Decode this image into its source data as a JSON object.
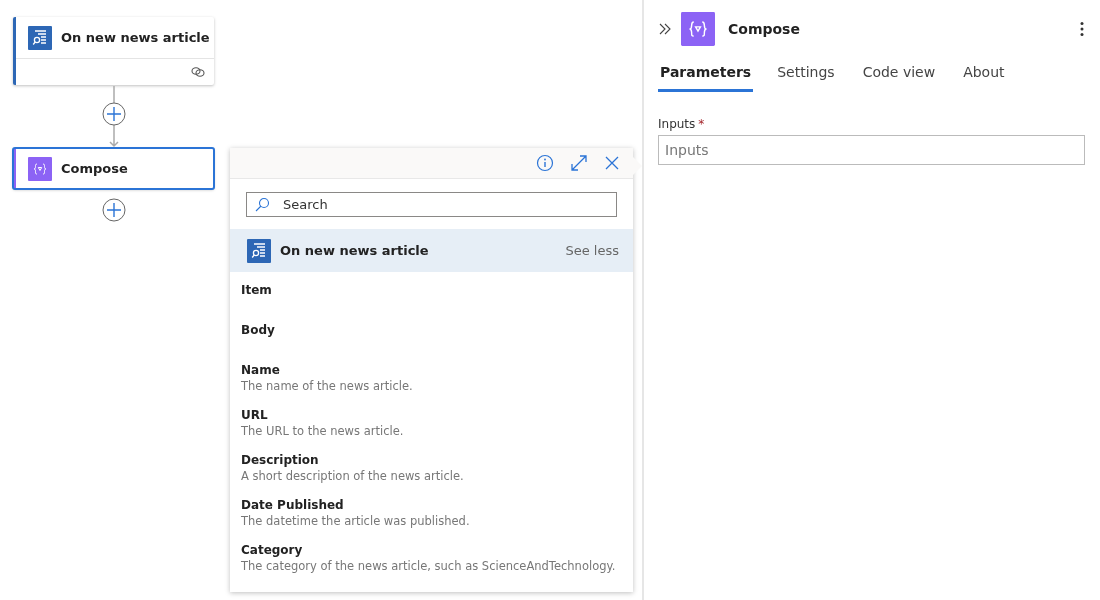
{
  "canvas": {
    "nodes": [
      {
        "title": "On new news article",
        "kind": "trigger",
        "selected": false
      },
      {
        "title": "Compose",
        "kind": "compose",
        "selected": true
      }
    ]
  },
  "dynamic_content": {
    "search": {
      "placeholder": "Search"
    },
    "group": {
      "title": "On new news article",
      "toggle": "See less"
    },
    "items": [
      {
        "title": "Item"
      },
      {
        "title": "Body"
      },
      {
        "title": "Name",
        "description": "The name of the news article."
      },
      {
        "title": "URL",
        "description": "The URL to the news article."
      },
      {
        "title": "Description",
        "description": "A short description of the news article."
      },
      {
        "title": "Date Published",
        "description": "The datetime the article was published."
      },
      {
        "title": "Category",
        "description": "The category of the news article, such as ScienceAndTechnology."
      }
    ]
  },
  "panel": {
    "title": "Compose",
    "tabs": [
      {
        "label": "Parameters",
        "selected": true
      },
      {
        "label": "Settings",
        "selected": false
      },
      {
        "label": "Code view",
        "selected": false
      },
      {
        "label": "About",
        "selected": false
      }
    ],
    "field": {
      "label": "Inputs",
      "required_mark": "*",
      "placeholder": "Inputs"
    }
  }
}
